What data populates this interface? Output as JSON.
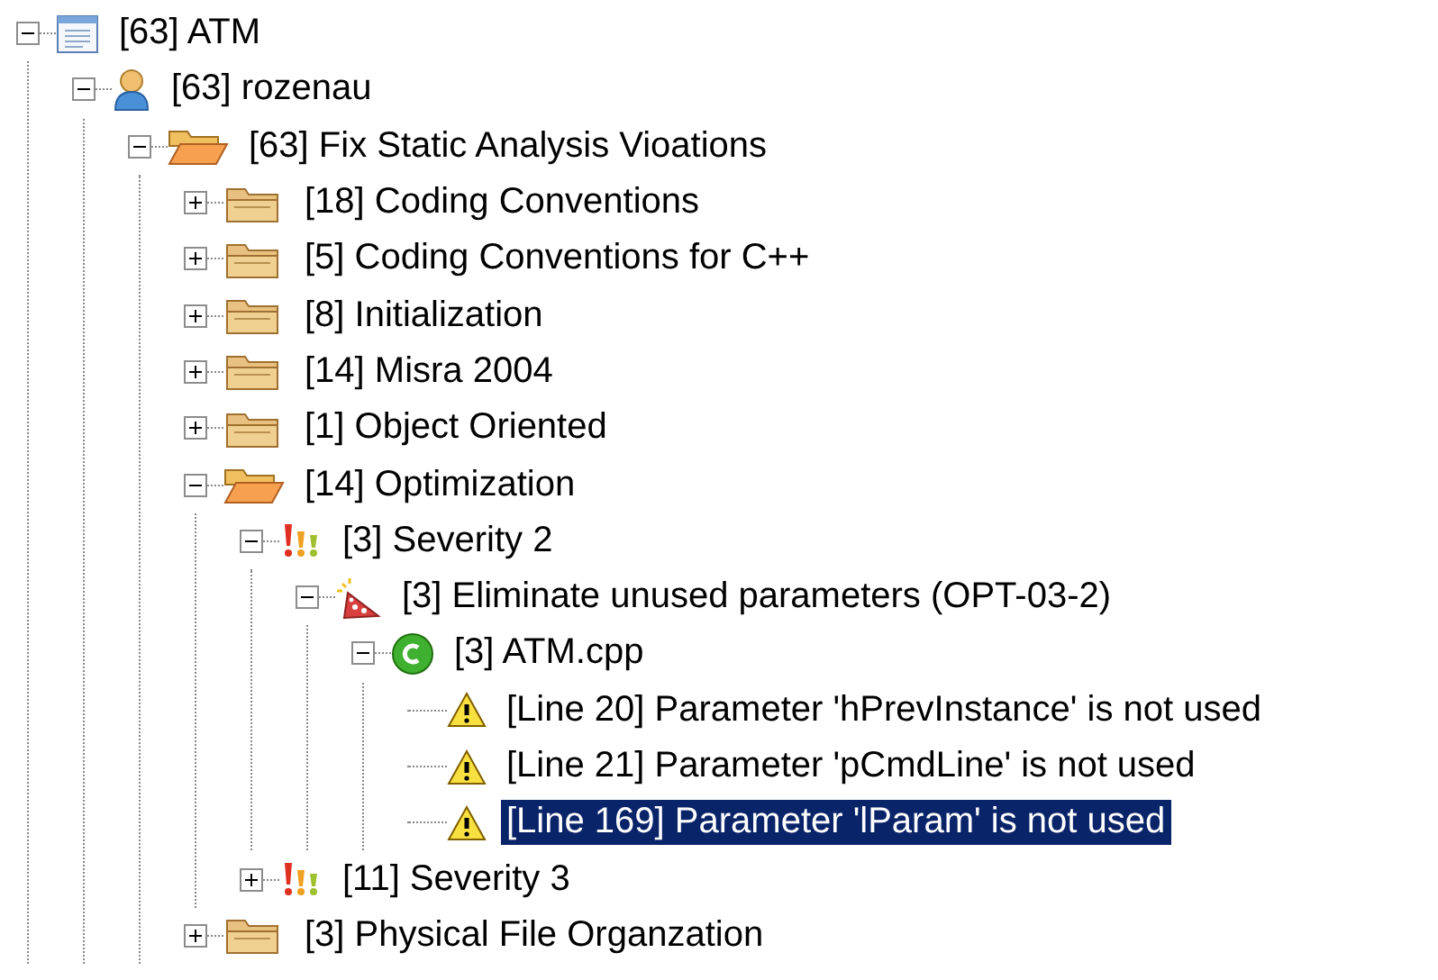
{
  "tree": {
    "items": [
      {
        "kind": "project",
        "label": "[63] ATM",
        "expanded": true,
        "selected": false,
        "children": [
          {
            "kind": "user",
            "label": "[63] rozenau",
            "expanded": true,
            "selected": false,
            "children": [
              {
                "kind": "folder",
                "label": "[63] Fix Static Analysis Vioations",
                "expanded": true,
                "selected": false,
                "children": [
                  {
                    "kind": "folder",
                    "label": "[18] Coding Conventions",
                    "expanded": false,
                    "selected": false
                  },
                  {
                    "kind": "folder",
                    "label": "[5] Coding Conventions for C++",
                    "expanded": false,
                    "selected": false
                  },
                  {
                    "kind": "folder",
                    "label": "[8] Initialization",
                    "expanded": false,
                    "selected": false
                  },
                  {
                    "kind": "folder",
                    "label": "[14] Misra 2004",
                    "expanded": false,
                    "selected": false
                  },
                  {
                    "kind": "folder",
                    "label": "[1] Object Oriented",
                    "expanded": false,
                    "selected": false
                  },
                  {
                    "kind": "folder",
                    "label": "[14] Optimization",
                    "expanded": true,
                    "selected": false,
                    "children": [
                      {
                        "kind": "severity",
                        "label": "[3] Severity 2",
                        "expanded": true,
                        "selected": false,
                        "children": [
                          {
                            "kind": "rule",
                            "label": "[3] Eliminate unused parameters (OPT-03-2)",
                            "expanded": true,
                            "selected": false,
                            "children": [
                              {
                                "kind": "file",
                                "label": "[3] ATM.cpp",
                                "expanded": true,
                                "selected": false,
                                "children": [
                                  {
                                    "kind": "warning",
                                    "label": "[Line 20] Parameter 'hPrevInstance' is not used",
                                    "selected": false
                                  },
                                  {
                                    "kind": "warning",
                                    "label": "[Line 21] Parameter 'pCmdLine' is not used",
                                    "selected": false
                                  },
                                  {
                                    "kind": "warning",
                                    "label": "[Line 169] Parameter 'lParam' is not used",
                                    "selected": true
                                  }
                                ]
                              }
                            ]
                          }
                        ]
                      },
                      {
                        "kind": "severity",
                        "label": "[11] Severity 3",
                        "expanded": false,
                        "selected": false
                      }
                    ]
                  },
                  {
                    "kind": "folder",
                    "label": "[3] Physical File Organzation",
                    "expanded": false,
                    "selected": false
                  }
                ]
              }
            ]
          }
        ]
      }
    ]
  }
}
